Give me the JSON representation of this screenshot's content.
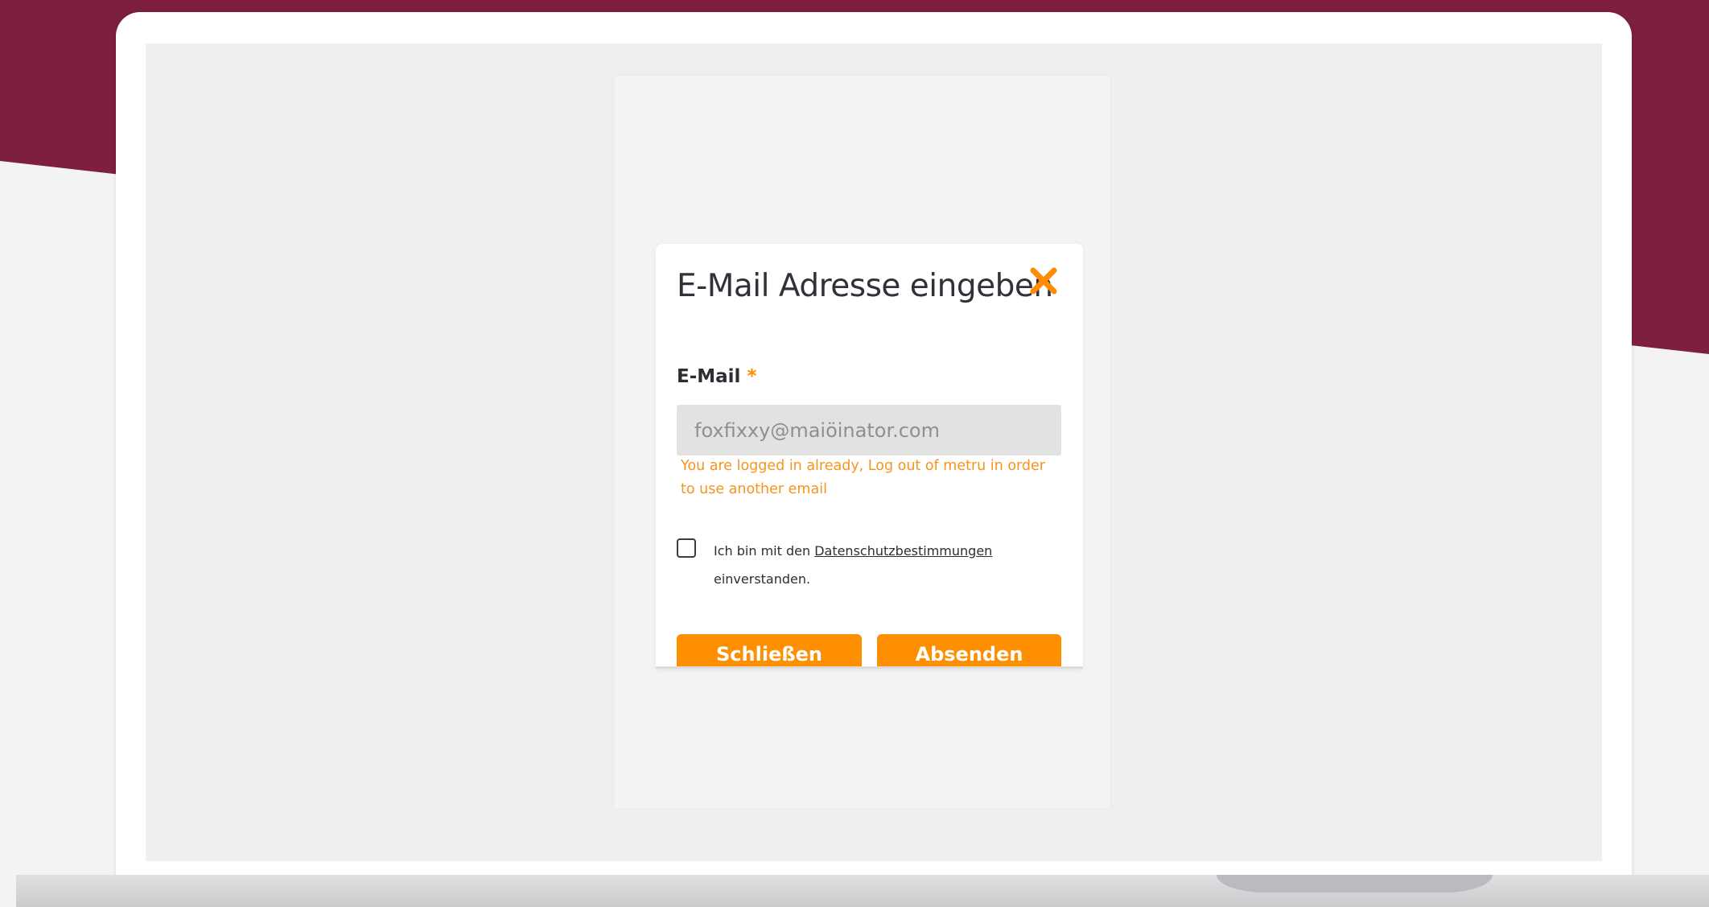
{
  "colors": {
    "banner": "#7e1f3e",
    "accent": "#ff8c00",
    "error": "#f7941d",
    "button": "#fd8f00"
  },
  "modal": {
    "title": "E-Mail Adresse eingeben",
    "close_icon": "close-x-icon",
    "email_field": {
      "label": "E-Mail",
      "required_marker": "*",
      "value": "foxfixxy@maiöinator.com",
      "error": "You are logged in already, Log out of metru in order to use another email"
    },
    "consent": {
      "prefix": "Ich bin mit den ",
      "link_text": "Datenschutzbestimmungen",
      "suffix": "einverstanden.",
      "checked": false
    },
    "buttons": {
      "close_label": "Schließen",
      "submit_label": "Absenden"
    }
  }
}
